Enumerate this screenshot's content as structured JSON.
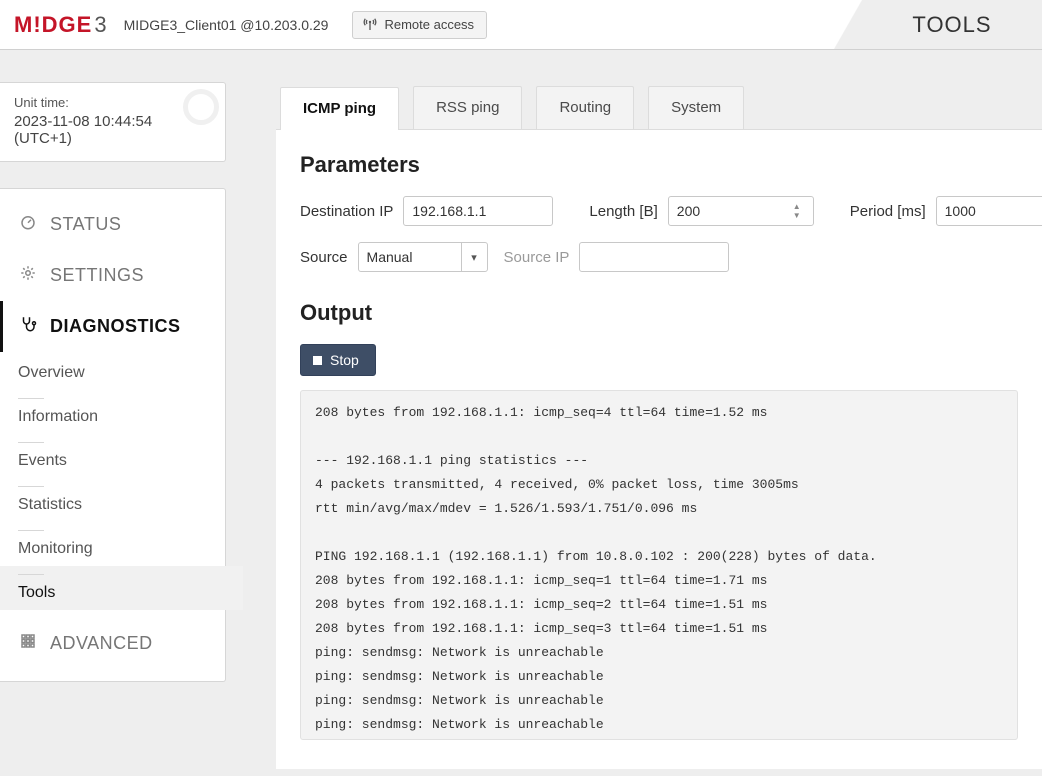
{
  "header": {
    "logo": "M!DGE",
    "logo_suffix": "3",
    "device": "MIDGE3_Client01 @10.203.0.29",
    "remote_label": "Remote access",
    "tools_label": "TOOLS"
  },
  "unit_time": {
    "label": "Unit time:",
    "value": "2023-11-08 10:44:54 (UTC+1)"
  },
  "nav": {
    "status": "STATUS",
    "settings": "SETTINGS",
    "diagnostics": "DIAGNOSTICS",
    "advanced": "ADVANCED",
    "diag_sub": {
      "overview": "Overview",
      "information": "Information",
      "events": "Events",
      "statistics": "Statistics",
      "monitoring": "Monitoring",
      "tools": "Tools"
    }
  },
  "tabs": {
    "icmp": "ICMP ping",
    "rss": "RSS ping",
    "routing": "Routing",
    "system": "System"
  },
  "params": {
    "heading": "Parameters",
    "dest_label": "Destination IP",
    "dest_value": "192.168.1.1",
    "length_label": "Length [B]",
    "length_value": "200",
    "period_label": "Period [ms]",
    "period_value": "1000",
    "source_label": "Source",
    "source_value": "Manual",
    "source_ip_label": "Source IP",
    "source_ip_value": ""
  },
  "output": {
    "heading": "Output",
    "stop_label": "Stop",
    "text": "208 bytes from 192.168.1.1: icmp_seq=4 ttl=64 time=1.52 ms\n\n--- 192.168.1.1 ping statistics ---\n4 packets transmitted, 4 received, 0% packet loss, time 3005ms\nrtt min/avg/max/mdev = 1.526/1.593/1.751/0.096 ms\n\nPING 192.168.1.1 (192.168.1.1) from 10.8.0.102 : 200(228) bytes of data.\n208 bytes from 192.168.1.1: icmp_seq=1 ttl=64 time=1.71 ms\n208 bytes from 192.168.1.1: icmp_seq=2 ttl=64 time=1.51 ms\n208 bytes from 192.168.1.1: icmp_seq=3 ttl=64 time=1.51 ms\nping: sendmsg: Network is unreachable\nping: sendmsg: Network is unreachable\nping: sendmsg: Network is unreachable\nping: sendmsg: Network is unreachable\nping: sendmsg: Network is unreachable"
  }
}
